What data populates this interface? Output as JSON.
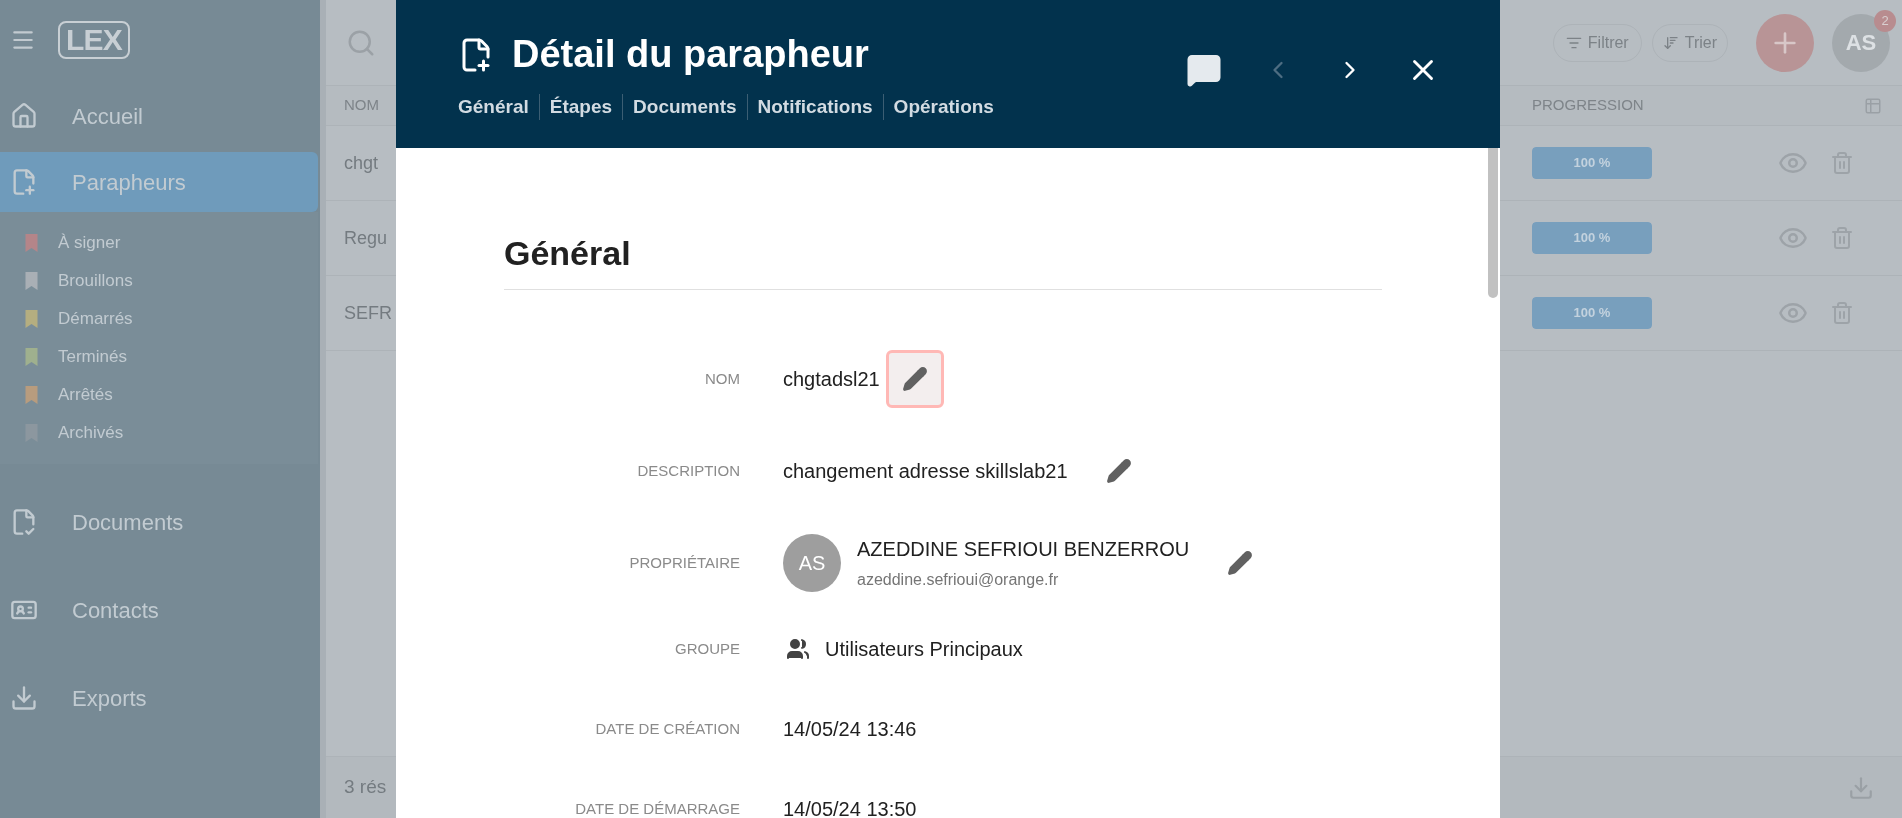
{
  "sidebar": {
    "logo": "LEX",
    "items": [
      {
        "label": "Accueil",
        "selected": false
      },
      {
        "label": "Parapheurs",
        "selected": true,
        "children": [
          {
            "label": "À signer",
            "color": "#b48589"
          },
          {
            "label": "Brouillons",
            "color": "#a9afb5"
          },
          {
            "label": "Démarrés",
            "color": "#b5ae80"
          },
          {
            "label": "Terminés",
            "color": "#9fb08e"
          },
          {
            "label": "Arrêtés",
            "color": "#b89c7e"
          },
          {
            "label": "Archivés",
            "color": "#8c979f"
          }
        ]
      },
      {
        "label": "Documents",
        "selected": false
      },
      {
        "label": "Contacts",
        "selected": false
      },
      {
        "label": "Exports",
        "selected": false
      }
    ]
  },
  "toolbar": {
    "filter": "Filtrer",
    "sort": "Trier",
    "avatar": "AS",
    "badge": "2"
  },
  "table": {
    "columns": [
      "NOM",
      "PROGRESSION"
    ],
    "rows": [
      {
        "name": "chgt",
        "level": 1,
        "reading": "100 %"
      },
      {
        "name": "Regu",
        "level": 1,
        "reading": "100 %"
      },
      {
        "name": "SEFR",
        "level": 1,
        "reading": "100 %"
      }
    ],
    "footer": "3 rés"
  },
  "dialog": {
    "title": "Détail du parapheur",
    "tabs": [
      {
        "label": "Général"
      },
      {
        "label": "Étapes"
      },
      {
        "label": "Documents"
      },
      {
        "label": "Notifications"
      },
      {
        "label": "Opérations"
      }
    ],
    "previous_disabled": true,
    "next_disabled": false,
    "section": "Général",
    "fields": [
      {
        "kind": "text",
        "label": "NOM",
        "value": "chgtadsl21",
        "edit_button": {
          "focused": true
        }
      },
      {
        "kind": "text",
        "label": "DESCRIPTION",
        "value": "changement adresse skillslab21",
        "edit_button": {
          "focused": false
        }
      },
      {
        "kind": "owner",
        "label": "PROPRIÉTAIRE",
        "initials": "AS",
        "value": "AZEDDINE SEFRIOUI BENZERROU",
        "email": "azeddine.sefrioui@orange.fr",
        "edit_button": {
          "focused": false
        }
      },
      {
        "kind": "group",
        "label": "GROUPE",
        "value": "Utilisateurs Principaux"
      },
      {
        "kind": "text",
        "label": "DATE DE CRÉATION",
        "value": "14/05/24 13:46"
      },
      {
        "kind": "text",
        "label": "DATE DE DÉMARRAGE",
        "value": "14/05/24 13:50"
      }
    ]
  }
}
